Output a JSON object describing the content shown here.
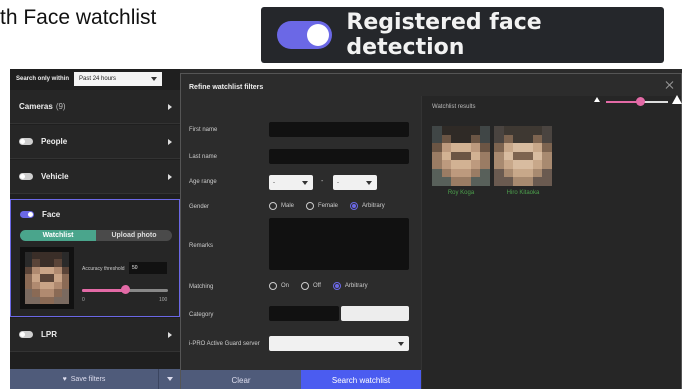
{
  "caption": {
    "text": "th Face watchlist"
  },
  "banner": {
    "label": "Registered face detection",
    "accent": "#6b68e6"
  },
  "sidebar": {
    "search_label": "Search only within",
    "search_value": "Past 24 hours",
    "cameras_label": "Cameras",
    "cameras_count": "(9)",
    "people_label": "People",
    "vehicle_label": "Vehicle",
    "face_label": "Face",
    "watchlist_tab": "Watchlist",
    "upload_tab": "Upload photo",
    "accuracy_label": "Accuracy threshold",
    "accuracy_value": "50",
    "accuracy_level": 0.5,
    "slider_min": "0",
    "slider_max": "100",
    "lpr_label": "LPR",
    "save_label": "Save filters"
  },
  "modal": {
    "title": "Refine watchlist filters",
    "first_name_label": "First name",
    "last_name_label": "Last name",
    "age_range_label": "Age range",
    "age_from": "-",
    "age_to": "-",
    "age_dash": "-",
    "gender_label": "Gender",
    "gender_options": [
      "Male",
      "Female",
      "Arbitrary"
    ],
    "gender_selected": "Arbitrary",
    "remarks_label": "Remarks",
    "matching_label": "Matching",
    "matching_options": [
      "On",
      "Off",
      "Arbitrary"
    ],
    "matching_selected": "Arbitrary",
    "category_label": "Category",
    "server_label": "i-PRO Active Guard server",
    "clear_label": "Clear",
    "search_label": "Search watchlist"
  },
  "results": {
    "title": "Watchlist results",
    "zoom_level": 0.55,
    "items": [
      {
        "name": "Roy Koga"
      },
      {
        "name": "Hiro Kitaoka"
      }
    ]
  }
}
